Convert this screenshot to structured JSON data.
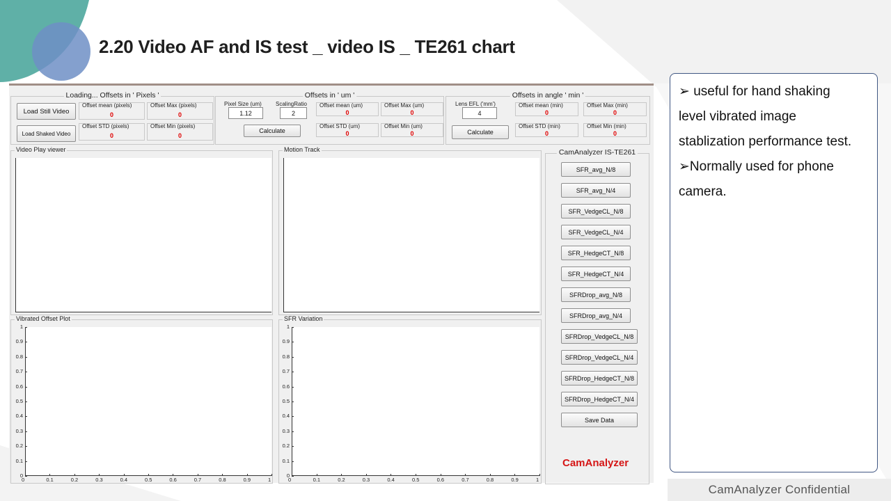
{
  "slide": {
    "title": "2.20  Video AF and IS test _ video IS _ TE261 chart",
    "footer": "CamAnalyzer  Confidential"
  },
  "colors": {
    "accent_teal": "#5fb0a7",
    "accent_blue": "#6f8fc5",
    "box_border": "#3f5682",
    "value_red": "#e00000",
    "logo_red": "#d51616"
  },
  "notes": {
    "bullet_1_lines": [
      "➢ useful for hand shaking",
      "level vibrated image",
      "stablization performance test."
    ],
    "bullet_2_lines": [
      "➢Normally  used for phone",
      "camera."
    ]
  },
  "app": {
    "pixels_panel": {
      "title": "Loading... Offsets in ' Pixels '",
      "load_still_button": "Load Still Video",
      "load_shaked_button": "Load Shaked Video",
      "stats": [
        {
          "label": "Offset mean (pixels)",
          "value": "0"
        },
        {
          "label": "Offset Max (pixels)",
          "value": "0"
        },
        {
          "label": "Offset STD (pixels)",
          "value": "0"
        },
        {
          "label": "Offset Min (pixels)",
          "value": "0"
        }
      ]
    },
    "um_panel": {
      "title": "Offsets in ' um '",
      "pixel_size_label": "Pixel Size (um)",
      "pixel_size_value": "1.12",
      "scaling_label": "ScalingRatio",
      "scaling_value": "2",
      "calculate_button": "Calculate",
      "stats": [
        {
          "label": "Offset mean (um)",
          "value": "0"
        },
        {
          "label": "Offset Max (um)",
          "value": "0"
        },
        {
          "label": "Offset STD (um)",
          "value": "0"
        },
        {
          "label": "Offset Min (um)",
          "value": "0"
        }
      ]
    },
    "angle_panel": {
      "title": "Offsets in angle ' min '",
      "lens_efl_label": "Lens EFL ('mm')",
      "lens_efl_value": "4",
      "calculate_button": "Calculate",
      "stats": [
        {
          "label": "Offset mean (min)",
          "value": "0"
        },
        {
          "label": "Offset Max (min)",
          "value": "0"
        },
        {
          "label": "Offset STD (min)",
          "value": "0"
        },
        {
          "label": "Offset Min (min)",
          "value": "0"
        }
      ]
    },
    "plots": {
      "video_viewer": "Video Play viewer",
      "motion_track": "Motion Track",
      "vibrated_offset": "Vibrated Offset Plot",
      "sfr_variation": "SFR  Variation",
      "x_ticks": [
        "0",
        "0.1",
        "0.2",
        "0.3",
        "0.4",
        "0.5",
        "0.6",
        "0.7",
        "0.8",
        "0.9",
        "1"
      ],
      "y_ticks": [
        "0",
        "0.1",
        "0.2",
        "0.3",
        "0.4",
        "0.5",
        "0.6",
        "0.7",
        "0.8",
        "0.9",
        "1"
      ]
    },
    "side_panel": {
      "title": "CamAnalyzer IS-TE261",
      "buttons": [
        "SFR_avg_N/8",
        "SFR_avg_N/4",
        "SFR_VedgeCL_N/8",
        "SFR_VedgeCL_N/4",
        "SFR_HedgeCT_N/8",
        "SFR_HedgeCT_N/4",
        "SFRDrop_avg_N/8",
        "SFRDrop_avg_N/4",
        "SFRDrop_VedgeCL_N/8",
        "SFRDrop_VedgeCL_N/4",
        "SFRDrop_HedgeCT_N/8",
        "SFRDrop_HedgeCT_N/4",
        "Save Data"
      ],
      "logo": "CamAnalyzer"
    }
  }
}
